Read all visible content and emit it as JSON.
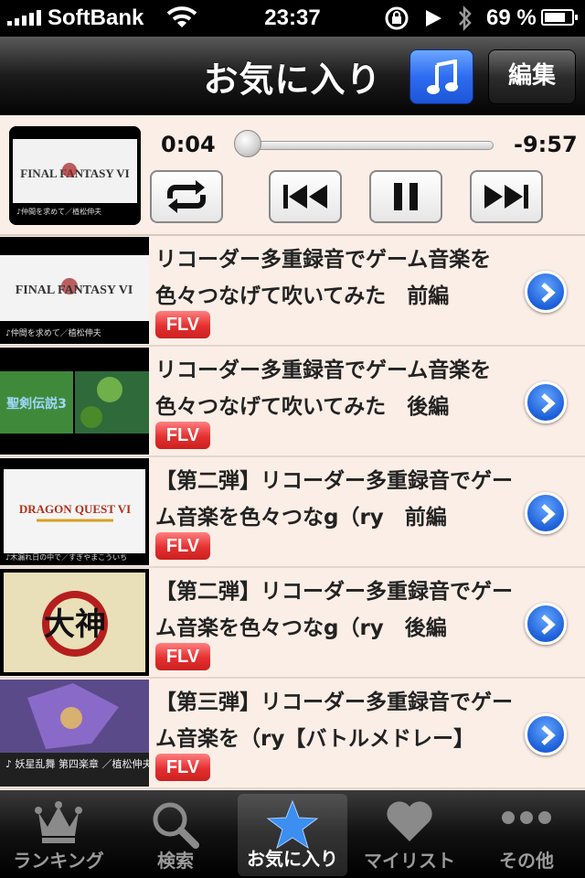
{
  "status_bar": {
    "carrier": "SoftBank",
    "time": "23:37",
    "battery": "69 %"
  },
  "nav": {
    "title": "お気に入り",
    "music_icon": "music-note-icon",
    "edit_label": "編集"
  },
  "player": {
    "elapsed": "0:04",
    "remaining": "-9:57",
    "progress": 0.01,
    "now_playing_title": "FINAL FANTASY VI",
    "now_playing_caption": "♪仲間を求めて／植松伸夫",
    "buttons": [
      "repeat-icon",
      "previous-icon",
      "pause-icon",
      "next-icon"
    ]
  },
  "items": [
    {
      "title": "リコーダー多重録音でゲーム音楽を色々つなげて吹いてみた　前編",
      "badge": "FLV",
      "thumb_title": "FINAL FANTASY VI",
      "thumb_caption": "♪仲間を求めて／植松伸夫"
    },
    {
      "title": "リコーダー多重録音でゲーム音楽を色々つなげて吹いてみた　後編",
      "badge": "FLV",
      "thumb_title": "聖剣伝説3",
      "thumb_caption": ""
    },
    {
      "title": "【第二弾】リコーダー多重録音でゲーム音楽を色々つなg（ry　前編",
      "badge": "FLV",
      "thumb_title": "DRAGON QUEST VI",
      "thumb_caption": "♪木漏れ日の中で／すぎやまこういち"
    },
    {
      "title": "【第二弾】リコーダー多重録音でゲーム音楽を色々つなg（ry　後編",
      "badge": "FLV",
      "thumb_title": "大神",
      "thumb_caption": ""
    },
    {
      "title": "【第三弾】リコーダー多重録音でゲーム音楽を（ry【バトルメドレー】",
      "badge": "FLV",
      "thumb_title": "",
      "thumb_caption": "♪ 妖星乱舞 第四楽章\n／植松伸夫"
    }
  ],
  "tabs": [
    {
      "label": "ランキング",
      "icon": "crown-icon",
      "active": false
    },
    {
      "label": "検索",
      "icon": "magnifier-icon",
      "active": false
    },
    {
      "label": "お気に入り",
      "icon": "star-icon",
      "active": true
    },
    {
      "label": "マイリスト",
      "icon": "heart-icon",
      "active": false
    },
    {
      "label": "その他",
      "icon": "more-dots-icon",
      "active": false
    }
  ],
  "colors": {
    "list_background": "#fbeee6",
    "flv_badge": "#e43030",
    "accent_blue": "#2d6cf0"
  }
}
